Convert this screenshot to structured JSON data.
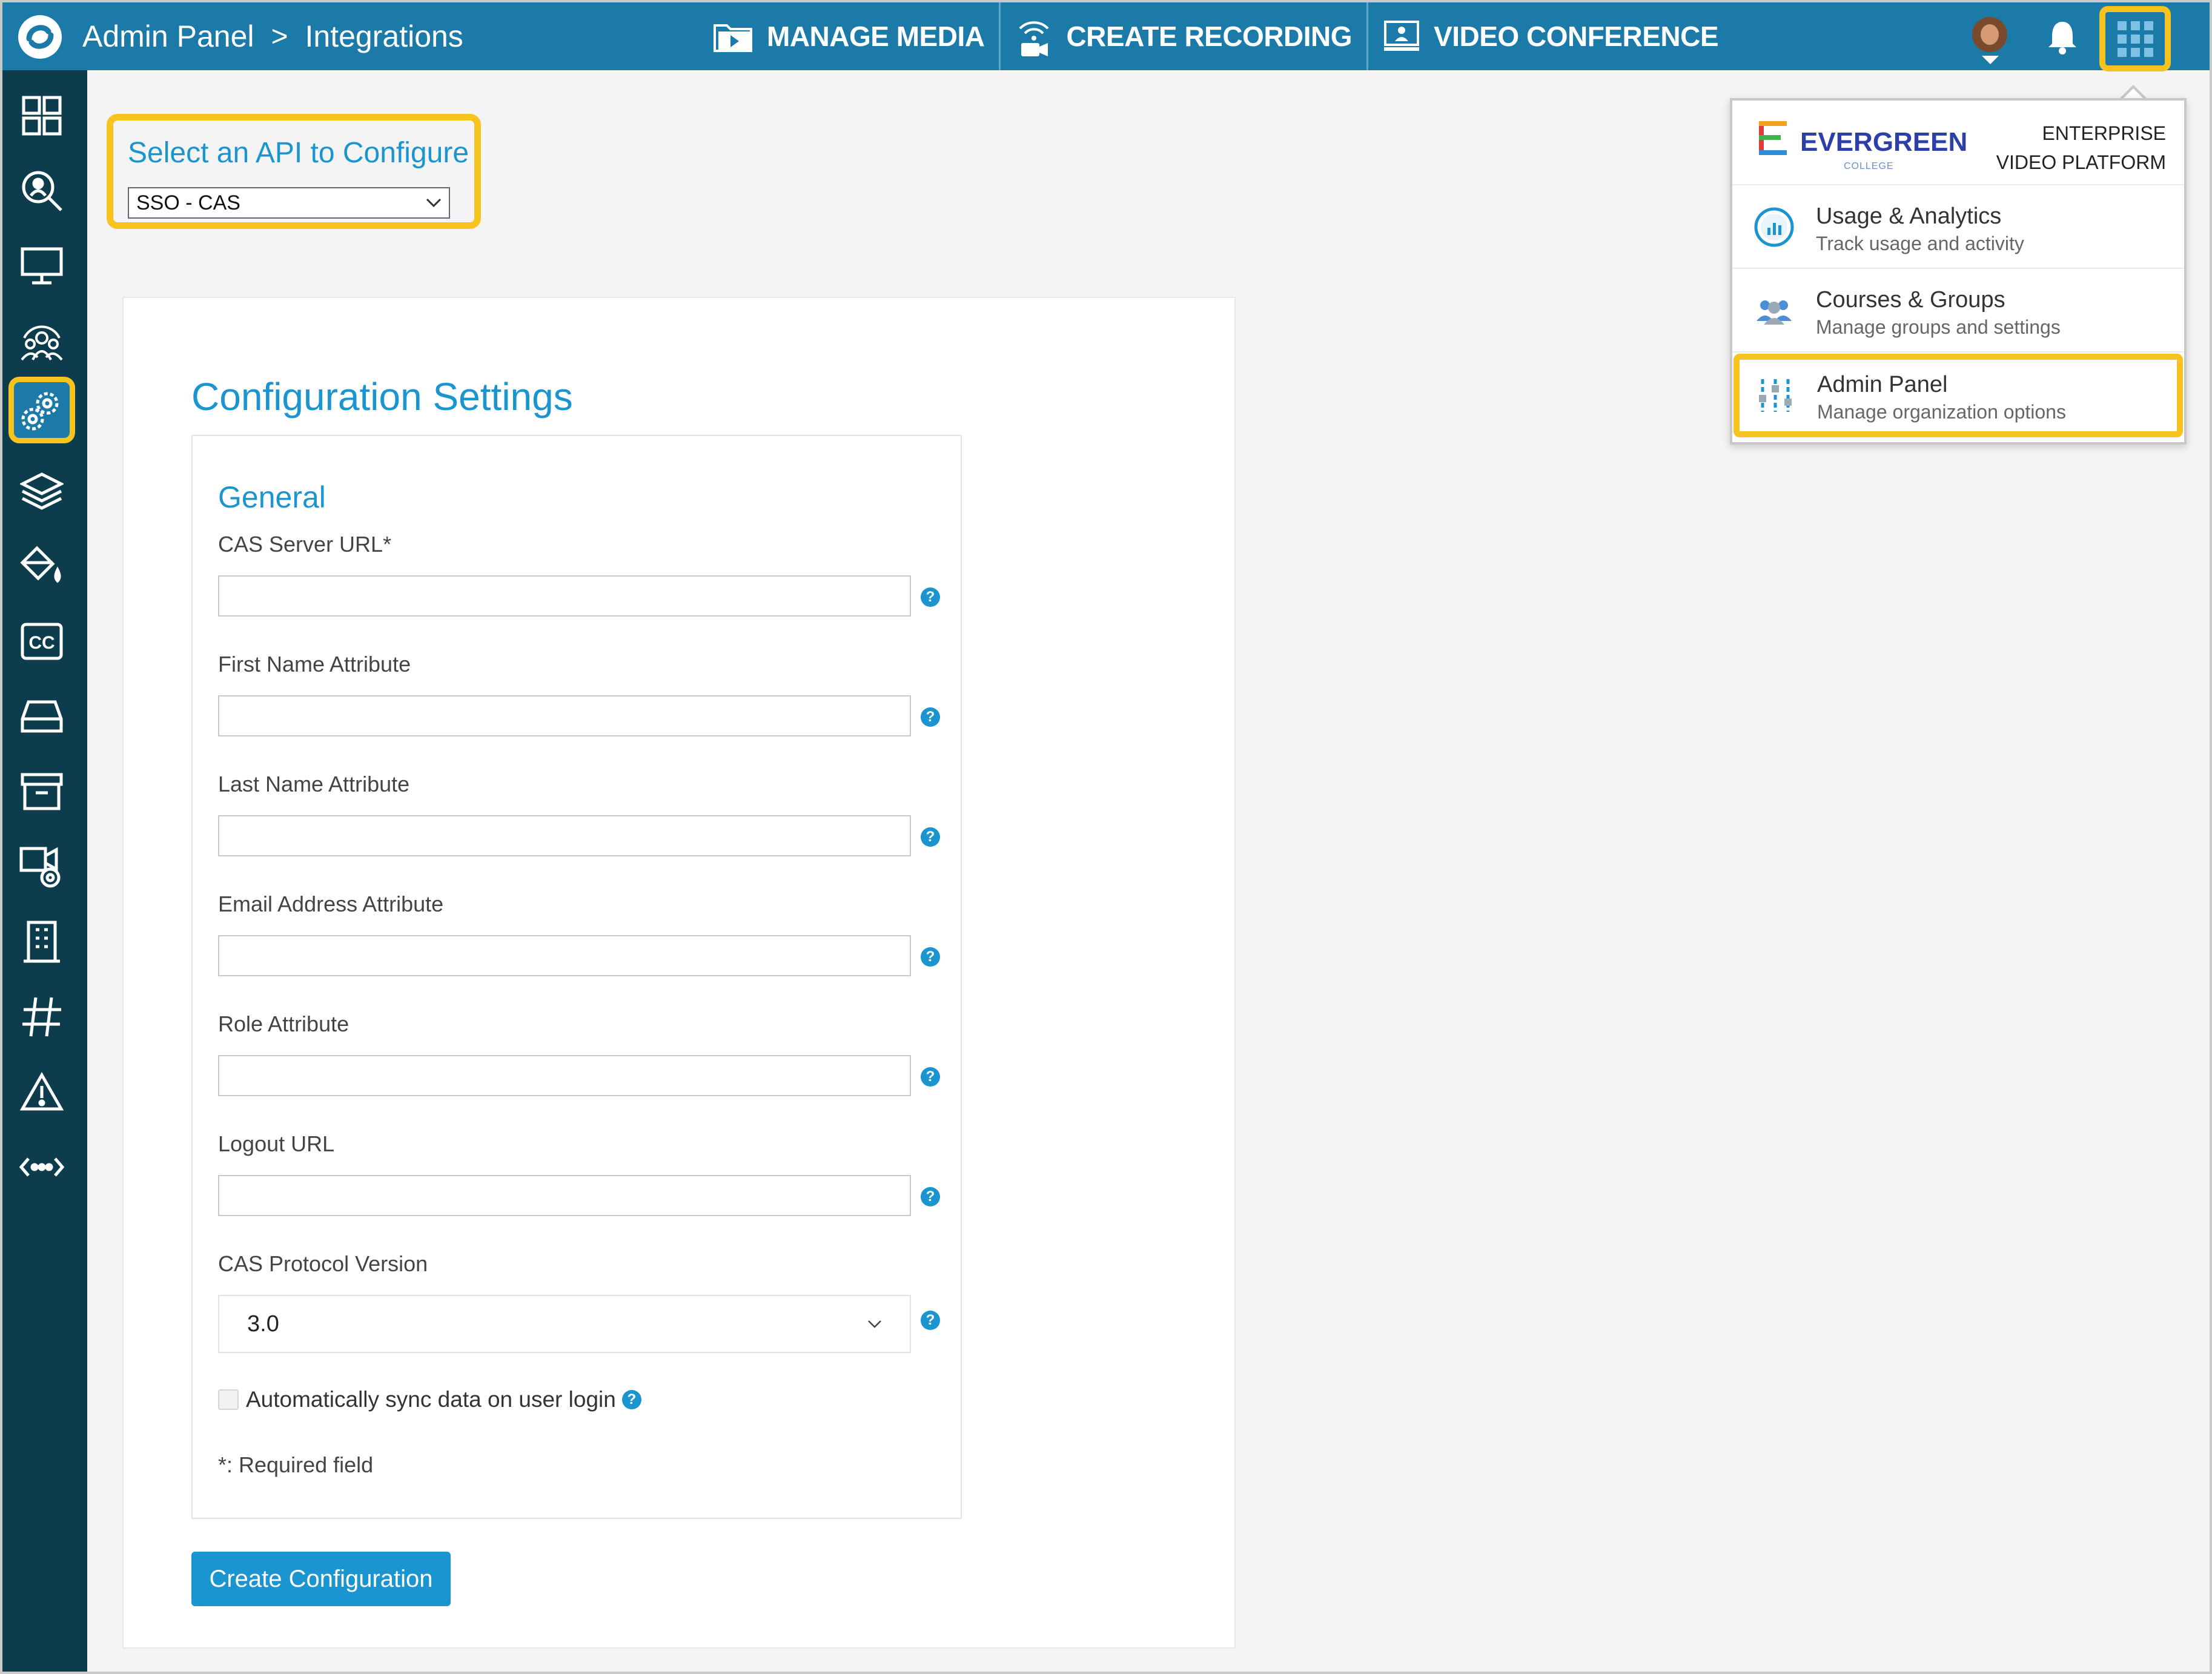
{
  "header": {
    "breadcrumb": [
      "Admin Panel",
      "Integrations"
    ],
    "separator": ">",
    "nav": [
      {
        "label": "MANAGE MEDIA",
        "icon": "media-folder-icon"
      },
      {
        "label": "CREATE RECORDING",
        "icon": "recording-camera-icon"
      },
      {
        "label": "VIDEO CONFERENCE",
        "icon": "video-conference-icon"
      }
    ],
    "bar_color": "#1b7aa8"
  },
  "sidebar": {
    "items": [
      {
        "icon": "dashboard-icon"
      },
      {
        "icon": "search-icon"
      },
      {
        "icon": "monitor-icon"
      },
      {
        "icon": "people-icon"
      },
      {
        "icon": "settings-icon",
        "active": true
      },
      {
        "icon": "layers-icon"
      },
      {
        "icon": "paint-bucket-icon"
      },
      {
        "icon": "closed-captions-icon"
      },
      {
        "icon": "drive-icon"
      },
      {
        "icon": "archive-icon"
      },
      {
        "icon": "video-settings-icon"
      },
      {
        "icon": "building-icon"
      },
      {
        "icon": "hashtag-icon"
      },
      {
        "icon": "warning-icon"
      },
      {
        "icon": "api-icon"
      }
    ]
  },
  "api_selector": {
    "title": "Select an API to Configure",
    "selected": "SSO - CAS"
  },
  "config": {
    "title": "Configuration Settings",
    "section": "General",
    "fields": [
      {
        "label": "CAS Server URL*",
        "value": ""
      },
      {
        "label": "First Name Attribute",
        "value": ""
      },
      {
        "label": "Last Name Attribute",
        "value": ""
      },
      {
        "label": "Email Address Attribute",
        "value": ""
      },
      {
        "label": "Role Attribute",
        "value": ""
      },
      {
        "label": "Logout URL",
        "value": ""
      }
    ],
    "protocol": {
      "label": "CAS Protocol Version",
      "selected": "3.0"
    },
    "sync_checkbox": {
      "label": "Automatically sync data on user login",
      "checked": false
    },
    "required_note": "*: Required field",
    "help_glyph": "?",
    "create_button": "Create Configuration"
  },
  "app_switcher": {
    "brand_name": "EVERGREEN",
    "brand_sub": "COLLEGE",
    "brand_tag": "ENTERPRISE VIDEO PLATFORM",
    "items": [
      {
        "title": "Usage & Analytics",
        "subtitle": "Track usage and activity",
        "icon": "analytics-icon"
      },
      {
        "title": "Courses & Groups",
        "subtitle": "Manage groups and settings",
        "icon": "groups-icon"
      },
      {
        "title": "Admin Panel",
        "subtitle": "Manage organization options",
        "icon": "admin-sliders-icon",
        "highlighted": true
      }
    ]
  },
  "colors": {
    "accent": "#1a95d0",
    "highlight": "#f7c31e",
    "sidebar": "#0d3d4d"
  }
}
